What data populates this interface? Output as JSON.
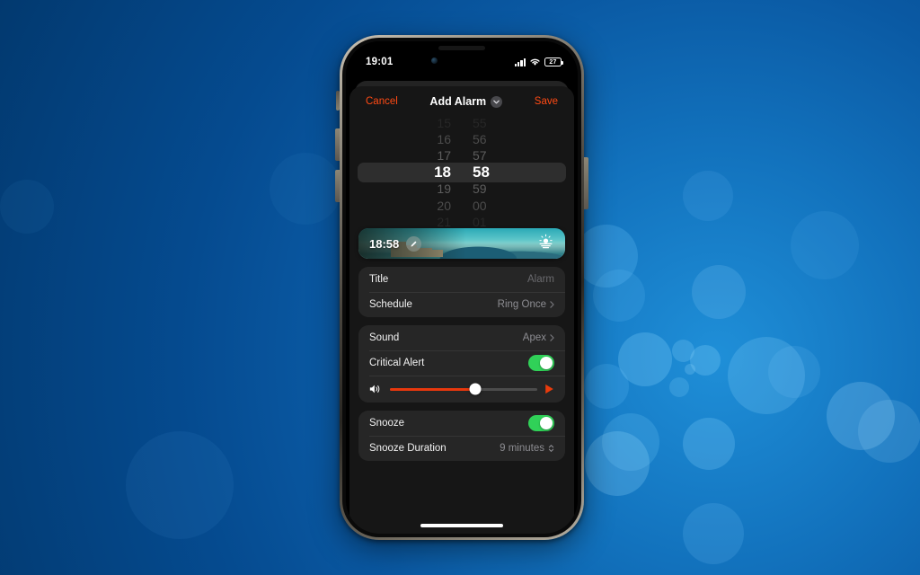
{
  "wallpaper": {
    "name": "blue-bokeh-wallpaper",
    "base_color": "#02386e",
    "accent_color": "#1f8fd8"
  },
  "status_bar": {
    "time": "19:01",
    "signal_icon": "cellular-signal-icon",
    "wifi_icon": "wifi-icon",
    "battery_icon": "battery-icon",
    "battery_level": "27"
  },
  "navbar": {
    "cancel_label": "Cancel",
    "title": "Add Alarm",
    "save_label": "Save",
    "chevron_icon": "chevron-down-icon",
    "accent_color": "#ff4a14"
  },
  "time_picker": {
    "selected_hour": "18",
    "selected_minute": "58",
    "hours": [
      "15",
      "16",
      "17",
      "18",
      "19",
      "20",
      "21"
    ],
    "minutes": [
      "55",
      "56",
      "57",
      "58",
      "59",
      "00",
      "01"
    ]
  },
  "preview_banner": {
    "time": "18:58",
    "edit_icon": "pencil-edit-icon",
    "sunrise_icon": "sunrise-icon",
    "photo_name": "coastal-landscape-photo"
  },
  "details_card": {
    "rows": [
      {
        "label": "Title",
        "value": "Alarm",
        "is_placeholder": true,
        "name": "row-title"
      },
      {
        "label": "Schedule",
        "value": "Ring Once",
        "chevron": "chevron-right-icon",
        "name": "row-schedule"
      }
    ]
  },
  "sound_card": {
    "sound_row": {
      "label": "Sound",
      "value": "Apex",
      "chevron": "chevron-right-icon"
    },
    "critical_alert_row": {
      "label": "Critical Alert",
      "toggle_state": "on"
    },
    "volume": {
      "speaker_icon": "speaker-wave-icon",
      "play_icon": "play-triangle-icon",
      "level_percent": 58,
      "fill_color": "#e8380d"
    }
  },
  "snooze_card": {
    "snooze_row": {
      "label": "Snooze",
      "toggle_state": "on"
    },
    "duration_row": {
      "label": "Snooze Duration",
      "value": "9 minutes",
      "stepper_icon": "chevron-up-down-icon"
    }
  },
  "toggle_on_color": "#30d158",
  "home_indicator": {
    "name": "home-indicator"
  }
}
